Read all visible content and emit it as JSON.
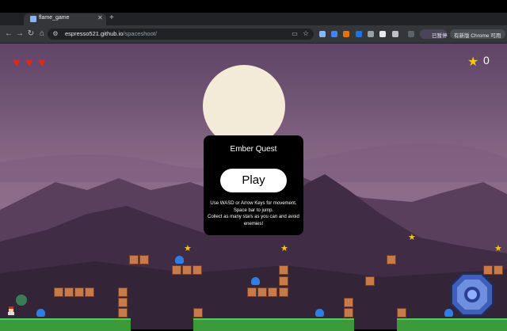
{
  "browser": {
    "tab_title": "flame_game",
    "url_host": "espresso521.github.io",
    "url_path": "/spaceshoot/",
    "profile_label": "已暂停",
    "update_label": "有新版 Chrome 可用"
  },
  "hud": {
    "lives": 3,
    "score": "0"
  },
  "overlay": {
    "title": "Ember Quest",
    "play_label": "Play",
    "instructions_line1": "Use WASD or Arrow Keys for movement.",
    "instructions_line2": "Space bar to jump.",
    "instructions_line3": "Collect as many stars as you can and avoid enemies!"
  },
  "colors": {
    "sky": "#6d4e72",
    "moon": "#f3ead8",
    "mountain": "#402c44",
    "ground": "#3a9a3a",
    "star": "#f5c518",
    "enemy": "#2f7ee6",
    "heart": "#e1261c"
  }
}
